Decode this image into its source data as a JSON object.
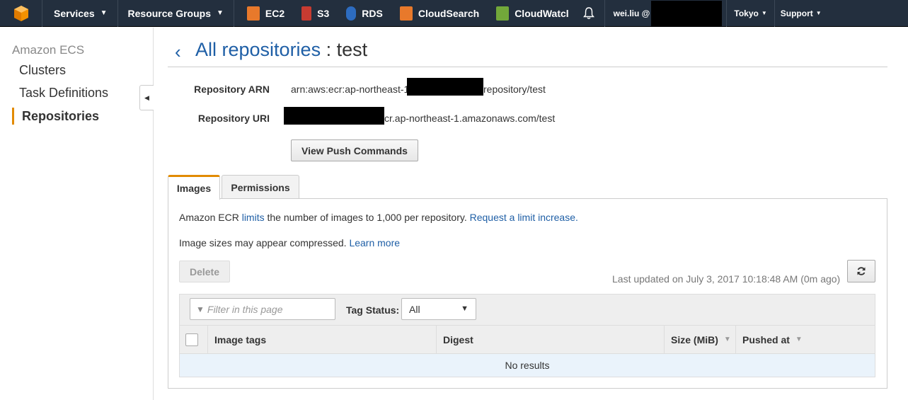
{
  "topnav": {
    "services": "Services",
    "resource_groups": "Resource Groups",
    "services_shortcuts": [
      {
        "label": "EC2",
        "icon": "ec2-icon",
        "color": "#e8792b"
      },
      {
        "label": "S3",
        "icon": "s3-icon",
        "color": "#c73b31"
      },
      {
        "label": "RDS",
        "icon": "rds-icon",
        "color": "#2d6cc0"
      },
      {
        "label": "CloudSearch",
        "icon": "cloudsearch-icon",
        "color": "#e8792b"
      },
      {
        "label": "CloudWatcl",
        "icon": "cloudwatch-icon",
        "color": "#72a83a"
      }
    ],
    "account_user": "wei.liu @",
    "region": "Tokyo",
    "support": "Support"
  },
  "sidebar": {
    "title": "Amazon ECS",
    "items": [
      {
        "label": "Clusters"
      },
      {
        "label": "Task Definitions"
      },
      {
        "label": "Repositories",
        "active": true
      }
    ]
  },
  "header": {
    "breadcrumb_link": "All repositories",
    "separator": " : ",
    "repo_name": "test"
  },
  "details": {
    "arn_label": "Repository ARN",
    "arn_prefix": "arn:aws:ecr:ap-northeast-1",
    "arn_suffix": "repository/test",
    "uri_label": "Repository URI",
    "uri_suffix": "cr.ap-northeast-1.amazonaws.com/test",
    "push_button": "View Push Commands"
  },
  "tabs": [
    {
      "label": "Images",
      "active": true
    },
    {
      "label": "Permissions",
      "active": false
    }
  ],
  "images_panel": {
    "limit_text_1": "Amazon ECR ",
    "limit_link": "limits",
    "limit_text_2": " the number of images to 1,000 per repository. ",
    "limit_increase_link": "Request a limit increase.",
    "compressed_text": "Image sizes may appear compressed. ",
    "learn_more_link": "Learn more",
    "delete_button": "Delete",
    "last_updated": "Last updated on July 3, 2017 10:18:48 AM (0m ago)",
    "filter_placeholder": "Filter in this page",
    "tag_status_label": "Tag Status:",
    "tag_status_value": "All",
    "columns": [
      "Image tags",
      "Digest",
      "Size (MiB)",
      "Pushed at"
    ],
    "empty_message": "No results"
  },
  "colors": {
    "nav_bg": "#232f3e",
    "accent_orange": "#e28b00",
    "link_blue": "#1f5fa6"
  }
}
